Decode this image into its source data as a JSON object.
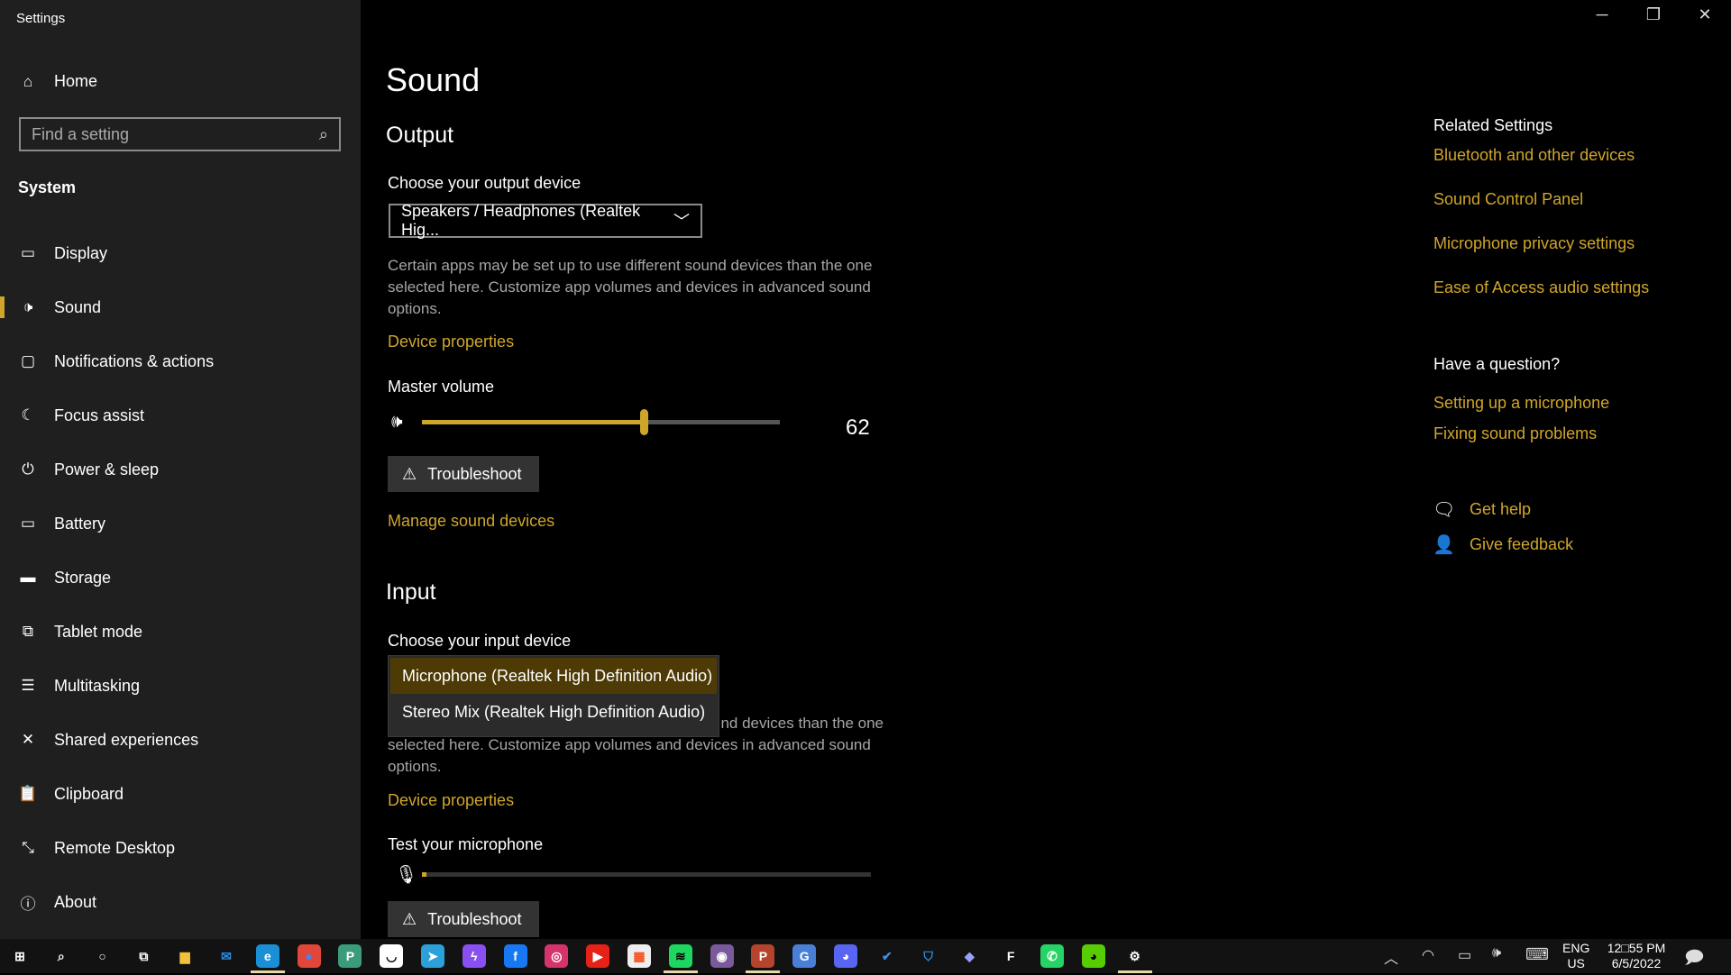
{
  "window": {
    "title": "Settings",
    "minimize_icon": "minimize-icon",
    "restore_icon": "restore-icon",
    "close_icon": "close-icon"
  },
  "sidebar": {
    "home": "Home",
    "search_placeholder": "Find a setting",
    "section": "System",
    "items": [
      {
        "label": "Display",
        "icon": "▭"
      },
      {
        "label": "Sound",
        "icon": "🕩"
      },
      {
        "label": "Notifications & actions",
        "icon": "▢"
      },
      {
        "label": "Focus assist",
        "icon": "☾"
      },
      {
        "label": "Power & sleep",
        "icon": "⏻"
      },
      {
        "label": "Battery",
        "icon": "▭"
      },
      {
        "label": "Storage",
        "icon": "▬"
      },
      {
        "label": "Tablet mode",
        "icon": "⧉"
      },
      {
        "label": "Multitasking",
        "icon": "☰"
      },
      {
        "label": "Shared experiences",
        "icon": "✕"
      },
      {
        "label": "Clipboard",
        "icon": "📋"
      },
      {
        "label": "Remote Desktop",
        "icon": "⤡"
      },
      {
        "label": "About",
        "icon": "ⓘ"
      }
    ],
    "active": "Sound"
  },
  "main": {
    "title": "Sound",
    "output": {
      "heading": "Output",
      "choose_label": "Choose your output device",
      "selected_device": "Speakers / Headphones (Realtek Hig...",
      "description": "Certain apps may be set up to use different sound devices than the one selected here. Customize app volumes and devices in advanced sound options.",
      "device_properties": "Device properties",
      "master_volume_label": "Master volume",
      "volume": 62,
      "volume_text": "62",
      "troubleshoot": "Troubleshoot",
      "manage": "Manage sound devices"
    },
    "input": {
      "heading": "Input",
      "choose_label": "Choose your input device",
      "options": [
        "Microphone (Realtek High Definition Audio)",
        "Stereo Mix (Realtek High Definition Audio)"
      ],
      "selected_index": 0,
      "description_visible": "nd devices than the one",
      "description_rest": "selected here. Customize app volumes and devices in advanced sound options.",
      "device_properties": "Device properties",
      "test_label": "Test your microphone",
      "mic_level": 1,
      "troubleshoot": "Troubleshoot"
    }
  },
  "related": {
    "heading": "Related Settings",
    "links": [
      "Bluetooth and other devices",
      "Sound Control Panel",
      "Microphone privacy settings",
      "Ease of Access audio settings"
    ],
    "question_heading": "Have a question?",
    "question_links": [
      "Setting up a microphone",
      "Fixing sound problems"
    ],
    "get_help": "Get help",
    "give_feedback": "Give feedback"
  },
  "colors": {
    "accent": "#d0a62a",
    "sidebar_bg": "#1f1f1f",
    "selected_option": "#4d3a05"
  },
  "taskbar": {
    "apps": [
      {
        "name": "start",
        "glyph": "⊞",
        "color": "#ffffff",
        "bg": "transparent"
      },
      {
        "name": "search",
        "glyph": "⌕",
        "color": "#ffffff",
        "bg": "transparent"
      },
      {
        "name": "cortana",
        "glyph": "○",
        "color": "#ffffff",
        "bg": "transparent"
      },
      {
        "name": "task-view",
        "glyph": "⧉",
        "color": "#ffffff",
        "bg": "transparent"
      },
      {
        "name": "file-explorer",
        "glyph": "▆",
        "color": "#f3c13a",
        "bg": "transparent"
      },
      {
        "name": "mail",
        "glyph": "✉",
        "color": "#2a8de0",
        "bg": "transparent"
      },
      {
        "name": "edge",
        "glyph": "e",
        "color": "#fff",
        "bg": "#1a8fd6"
      },
      {
        "name": "chrome",
        "glyph": "●",
        "color": "#4285f4",
        "bg": "#e0463a"
      },
      {
        "name": "app-p",
        "glyph": "P",
        "color": "#fff",
        "bg": "#3b9c7c"
      },
      {
        "name": "app-bot",
        "glyph": "◡",
        "color": "#000",
        "bg": "#fff"
      },
      {
        "name": "telegram",
        "glyph": "➤",
        "color": "#fff",
        "bg": "#2ba0d9"
      },
      {
        "name": "messenger",
        "glyph": "ϟ",
        "color": "#fff",
        "bg": "#8a4ff0"
      },
      {
        "name": "facebook",
        "glyph": "f",
        "color": "#fff",
        "bg": "#1877f2"
      },
      {
        "name": "instagram",
        "glyph": "◎",
        "color": "#fff",
        "bg": "#d6336c"
      },
      {
        "name": "youtube",
        "glyph": "▶",
        "color": "#fff",
        "bg": "#e62117"
      },
      {
        "name": "store",
        "glyph": "▦",
        "color": "#f25022",
        "bg": "#eee"
      },
      {
        "name": "spotify",
        "glyph": "≋",
        "color": "#000",
        "bg": "#1ed760"
      },
      {
        "name": "groove",
        "glyph": "◉",
        "color": "#fff",
        "bg": "#7a5a9a"
      },
      {
        "name": "app-p-red",
        "glyph": "P",
        "color": "#fff",
        "bg": "#b5442c"
      },
      {
        "name": "translate",
        "glyph": "G",
        "color": "#fff",
        "bg": "#4a7fd8"
      },
      {
        "name": "discord",
        "glyph": "◕",
        "color": "#fff",
        "bg": "#5865f2"
      },
      {
        "name": "todo",
        "glyph": "✔",
        "color": "#3c8de6",
        "bg": "transparent"
      },
      {
        "name": "defender",
        "glyph": "⛉",
        "color": "#2f8fe0",
        "bg": "transparent"
      },
      {
        "name": "xbox",
        "glyph": "◆",
        "color": "#9aa0ff",
        "bg": "transparent"
      },
      {
        "name": "app-f",
        "glyph": "F",
        "color": "#fff",
        "bg": "transparent"
      },
      {
        "name": "whatsapp",
        "glyph": "✆",
        "color": "#fff",
        "bg": "#25d366"
      },
      {
        "name": "duolingo",
        "glyph": "◕",
        "color": "#000",
        "bg": "#58cc02"
      },
      {
        "name": "settings",
        "glyph": "⚙",
        "color": "#fff",
        "bg": "transparent"
      }
    ],
    "active": [
      "edge",
      "spotify",
      "app-p-red",
      "settings"
    ],
    "lang_top": "ENG",
    "lang_bottom": "US",
    "time": "12□55 PM",
    "date": "6/5/2022"
  }
}
